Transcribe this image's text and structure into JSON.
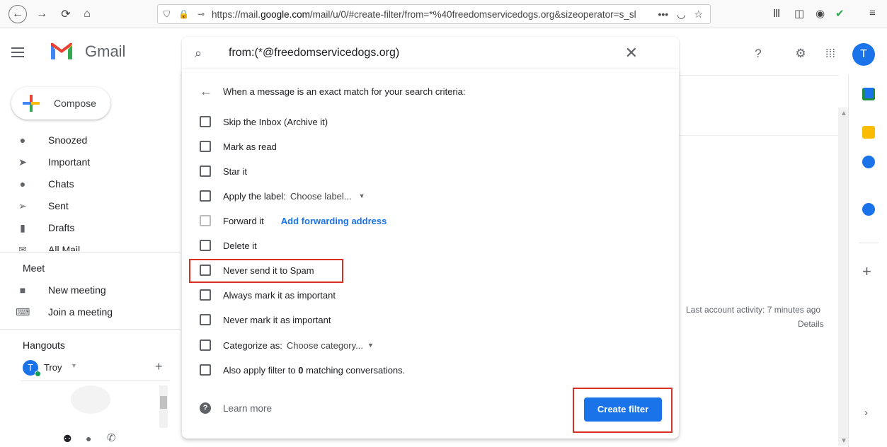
{
  "browser": {
    "url_prefix": "https://mail.",
    "url_domain": "google.com",
    "url_rest": "/mail/u/0/#create-filter/from=*%40freedomservicedogs.org&sizeoperator=s_sl",
    "more_label": "•••"
  },
  "gmail": {
    "logo_text": "Gmail",
    "search_value": "from:(*@freedomservicedogs.org)",
    "avatar_letter": "T"
  },
  "sidebar": {
    "compose_label": "Compose",
    "items": [
      {
        "label": "Snoozed"
      },
      {
        "label": "Important"
      },
      {
        "label": "Chats"
      },
      {
        "label": "Sent"
      },
      {
        "label": "Drafts"
      },
      {
        "label": "All Mail"
      }
    ],
    "meet_title": "Meet",
    "meet_items": [
      {
        "label": "New meeting"
      },
      {
        "label": "Join a meeting"
      }
    ],
    "hangouts_title": "Hangouts",
    "hangouts_user": "Troy",
    "hangouts_avatar": "T"
  },
  "main": {
    "activity": "Last account activity: 7 minutes ago",
    "details": "Details"
  },
  "filter": {
    "heading": "When a message is an exact match for your search criteria:",
    "options": {
      "skip_inbox": "Skip the Inbox (Archive it)",
      "mark_read": "Mark as read",
      "star": "Star it",
      "apply_label": "Apply the label:",
      "label_select": "Choose label...",
      "forward": "Forward it",
      "forward_link": "Add forwarding address",
      "delete": "Delete it",
      "never_spam": "Never send it to Spam",
      "always_important": "Always mark it as important",
      "never_important": "Never mark it as important",
      "categorize": "Categorize as:",
      "category_select": "Choose category...",
      "also_apply_pre": "Also apply filter to",
      "also_apply_count": "0",
      "also_apply_post": "matching conversations."
    },
    "learn_more": "Learn more",
    "create_button": "Create filter"
  },
  "colors": {
    "accent": "#1a73e8",
    "highlight": "#d93025"
  }
}
